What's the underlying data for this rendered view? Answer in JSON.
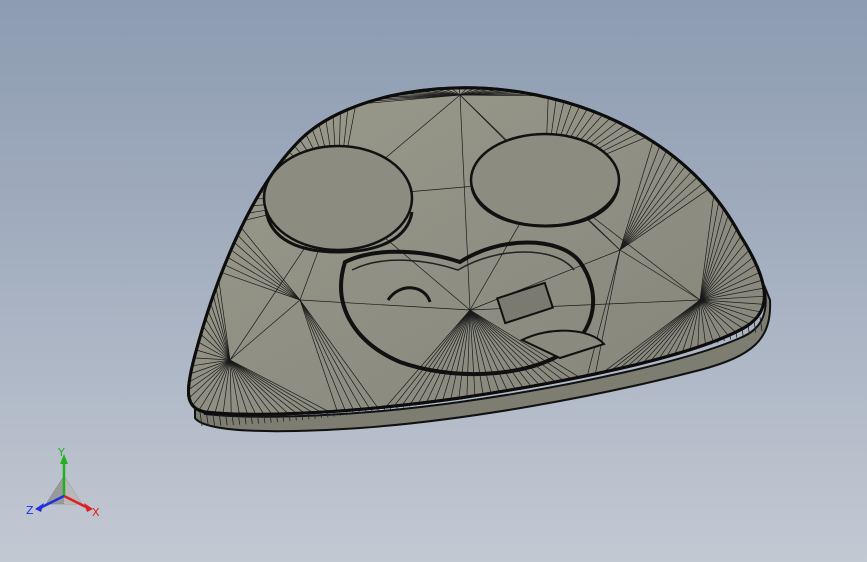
{
  "viewport": {
    "background_top": "#8d9cb1",
    "background_bottom": "#c3c9d3"
  },
  "model": {
    "face_color": "#8f8f82",
    "edge_color": "#111111",
    "mesh_color": "#1a1a1a"
  },
  "triad": {
    "x_label": "X",
    "y_label": "Y",
    "z_label": "Z",
    "x_color": "#e02020",
    "y_color": "#20b020",
    "z_color": "#2030e0"
  }
}
